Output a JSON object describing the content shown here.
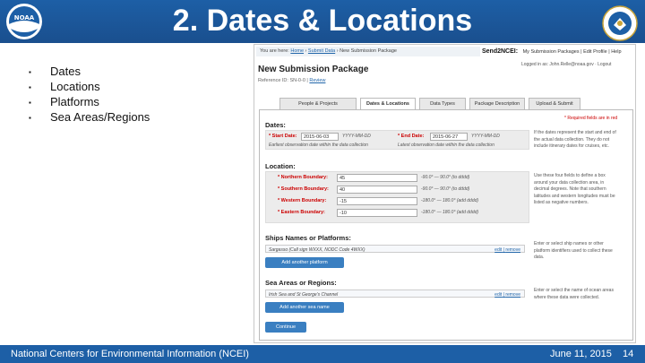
{
  "slide": {
    "title": "2. Dates & Locations",
    "bullets": [
      "Dates",
      "Locations",
      "Platforms",
      "Sea Areas/Regions"
    ],
    "footer": {
      "org": "National Centers for Environmental Information (NCEI)",
      "date": "June 11, 2015",
      "page": "14"
    }
  },
  "colors": {
    "brand_blue": "#1d5fa6",
    "button_blue": "#3a7fc1",
    "required_red": "#cc0000"
  },
  "screenshot": {
    "breadcrumb": {
      "prefix": "You are here:",
      "home": "Home",
      "submit": "Submit Data",
      "current": "New Submission Package"
    },
    "send2ncei": "Send2NCEI:",
    "top_links": [
      "My Submission Packages",
      "Edit Profile",
      "Help"
    ],
    "logged_in": "Logged in as: John.Relle@noaa.gov · Logout",
    "page_heading": "New Submission Package",
    "reference": {
      "text": "Reference ID: SN-0-0",
      "link": "Review"
    },
    "tabs": [
      "People & Projects",
      "Dates & Locations",
      "Data Types",
      "Package Description",
      "Upload & Submit"
    ],
    "required_note": "* Required fields are in red",
    "dates": {
      "heading": "Dates:",
      "start_label": "* Start Date:",
      "start_value": "2015-06-03",
      "start_format": "YYYY-MM-DD",
      "start_hint": "Earliest observation date within the data collection",
      "end_label": "* End Date:",
      "end_value": "2015-06-27",
      "end_format": "YYYY-MM-DD",
      "end_hint": "Latest observation date within the data collection",
      "side_text": "If the dates represent the start and end of the actual data collection. They do not include itinerary dates for cruises, etc."
    },
    "location": {
      "heading": "Location:",
      "rows": [
        {
          "label": "* Northern Boundary:",
          "value": "45",
          "range": "-90.0° — 90.0° (to dddd)"
        },
        {
          "label": "* Southern Boundary:",
          "value": "40",
          "range": "-90.0° — 90.0° (to dddd)"
        },
        {
          "label": "* Western Boundary:",
          "value": "-15",
          "range": "-180.0° — 180.0° (add dddd)"
        },
        {
          "label": "* Eastern Boundary:",
          "value": "-10",
          "range": "-180.0° — 180.0° (add dddd)"
        }
      ],
      "side_text": "Use these four fields to define a box around your data collection area, in decimal degrees. Note that southern latitudes and western longitudes must be listed as negative numbers."
    },
    "platforms": {
      "heading": "Ships Names or Platforms:",
      "item": "Sargasso (Call sign WXXX, NODC Code 4WXX)",
      "edit": "edit",
      "remove": "remove",
      "add_button": "Add another platform",
      "side_text": "Enter or select ship names or other platform identifiers used to collect these data."
    },
    "sea_areas": {
      "heading": "Sea Areas or Regions:",
      "item": "Irish Sea and St George's Channel",
      "edit": "edit",
      "remove": "remove",
      "add_button": "Add another sea name",
      "side_text": "Enter or select the name of ocean areas where these data were collected."
    },
    "continue_button": "Continue"
  }
}
